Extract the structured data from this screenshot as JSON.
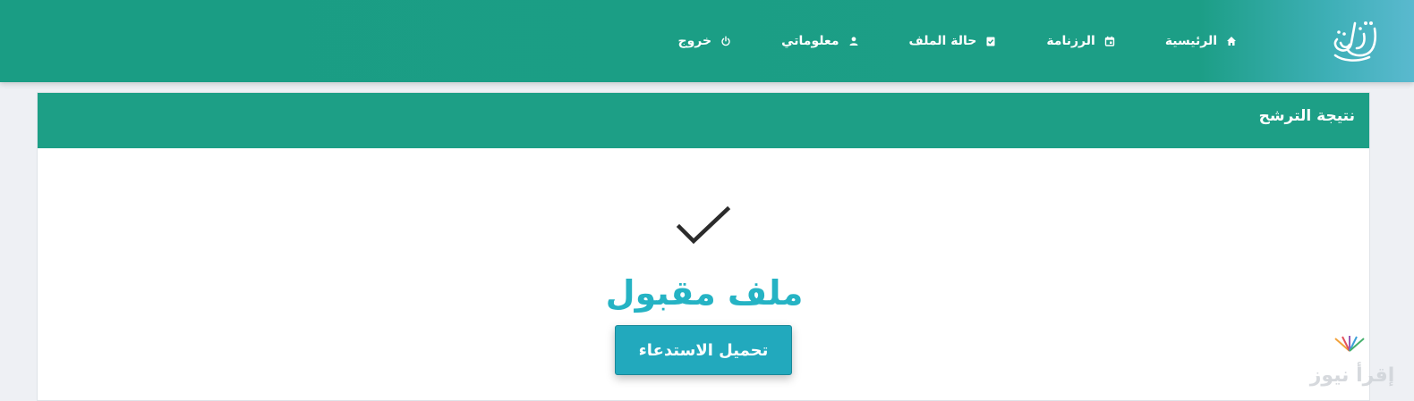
{
  "brand": {
    "logo_text": "توظيف"
  },
  "nav": {
    "items": [
      {
        "label": "الرئيسية",
        "icon": "home-icon"
      },
      {
        "label": "الرزنامة",
        "icon": "calendar-icon"
      },
      {
        "label": "حالة الملف",
        "icon": "clipboard-check-icon"
      },
      {
        "label": "معلوماتي",
        "icon": "user-icon"
      },
      {
        "label": "خروج",
        "icon": "power-icon"
      }
    ]
  },
  "card": {
    "title": "نتيجة الترشح",
    "status": "ملف مقبول",
    "download_label": "تحميل الاستدعاء"
  },
  "watermark": {
    "text": "إقرأ نيوز"
  },
  "colors": {
    "header_green": "#1a9d84",
    "accent_teal": "#25b3c4",
    "button_teal": "#22a9bd"
  }
}
